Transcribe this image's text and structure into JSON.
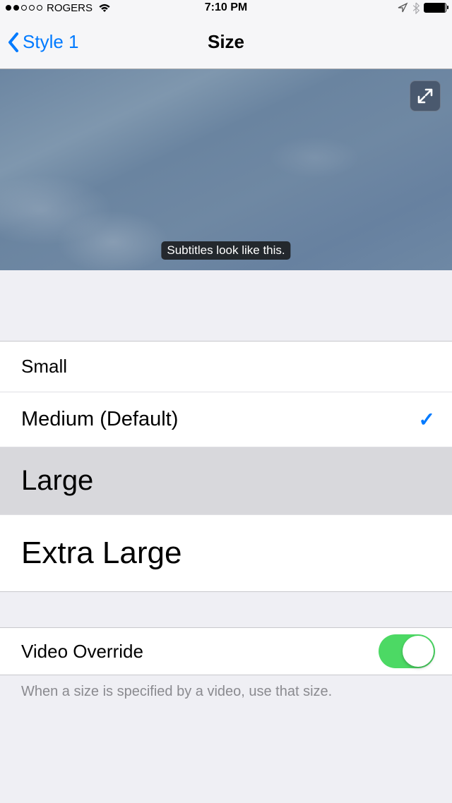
{
  "status": {
    "carrier": "ROGERS",
    "time": "7:10 PM"
  },
  "nav": {
    "back_label": "Style 1",
    "title": "Size"
  },
  "preview": {
    "subtitle_text": "Subtitles look like this."
  },
  "sizes": [
    {
      "label": "Small",
      "selected": false
    },
    {
      "label": "Medium (Default)",
      "selected": true
    },
    {
      "label": "Large",
      "selected": false
    },
    {
      "label": "Extra Large",
      "selected": false
    }
  ],
  "override": {
    "label": "Video Override",
    "enabled": true,
    "description": "When a size is specified by a video, use that size."
  }
}
